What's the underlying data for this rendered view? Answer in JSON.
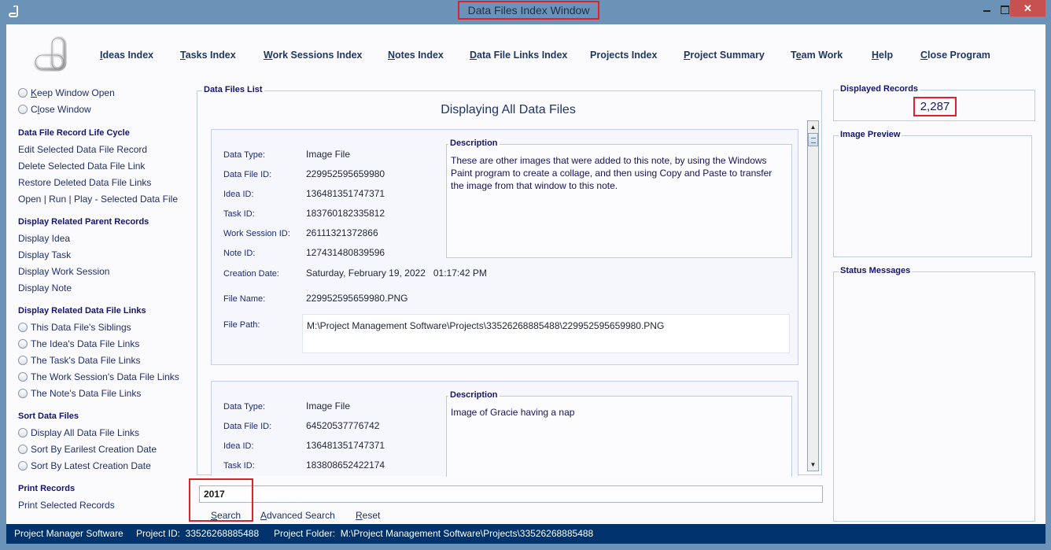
{
  "window": {
    "title": "Data Files Index Window",
    "close_glyph": "✕"
  },
  "nav": [
    {
      "mnemonic": "I",
      "rest": "deas Index"
    },
    {
      "mnemonic": "T",
      "rest": "asks Index"
    },
    {
      "mnemonic": "W",
      "rest": "ork Sessions Index"
    },
    {
      "mnemonic": "N",
      "rest": "otes Index"
    },
    {
      "mnemonic": "D",
      "rest": "ata File Links Index"
    },
    {
      "mnemonic": "",
      "rest": "Projects Index"
    },
    {
      "mnemonic": "P",
      "rest": "roject Summary"
    },
    {
      "pre": "T",
      "mnemonic": "e",
      "rest": "am Work"
    },
    {
      "mnemonic": "H",
      "rest": "elp"
    },
    {
      "mnemonic": "C",
      "rest": "lose Program"
    }
  ],
  "sidebar": {
    "window_options": [
      {
        "pre": "",
        "mnemonic": "K",
        "rest": "eep Window Open"
      },
      {
        "pre": "C",
        "mnemonic": "l",
        "rest": "ose Window"
      }
    ],
    "lifecycle": {
      "heading": "Data File Record Life Cycle",
      "items": [
        "Edit Selected Data File Record",
        "Delete Selected Data File Link",
        "Restore Deleted Data File Links",
        "Open | Run | Play - Selected Data File"
      ]
    },
    "parents": {
      "heading": "Display Related Parent Records",
      "items": [
        "Display Idea",
        "Display Task",
        "Display Work Session",
        "Display Note"
      ]
    },
    "links": {
      "heading": "Display Related Data File Links",
      "items": [
        "This Data File's Siblings",
        "The Idea's Data File Links",
        "The Task's Data File Links",
        "The Work Session's Data File Links",
        "The Note's Data File Links"
      ]
    },
    "sort": {
      "heading": "Sort Data Files",
      "items": [
        "Display All Data File Links",
        "Sort By Earilest Creation Date",
        "Sort By Latest Creation Date"
      ]
    },
    "print": {
      "heading": "Print Records",
      "items": [
        "Print Selected Records"
      ]
    }
  },
  "list": {
    "legend": "Data Files List",
    "heading": "Displaying All Data Files",
    "labels": {
      "data_type": "Data Type:",
      "data_file_id": "Data File ID:",
      "idea_id": "Idea ID:",
      "task_id": "Task ID:",
      "work_session_id": "Work Session ID:",
      "note_id": "Note ID:",
      "creation_date": "Creation Date:",
      "file_name": "File Name:",
      "file_path": "File Path:",
      "description": "Description"
    },
    "records": [
      {
        "data_type": "Image File",
        "data_file_id": "229952595659980",
        "idea_id": "136481351747371",
        "task_id": "183760182335812",
        "work_session_id": "26111321372866",
        "note_id": "127431480839596",
        "creation_date": "Saturday, February 19, 2022   01:17:42 PM",
        "file_name": "229952595659980.PNG",
        "file_path": "M:\\Project Management Software\\Projects\\33526268885488\\229952595659980.PNG",
        "description": "These are other images that were added to this note, by using the Windows Paint program to create a collage, and then using Copy and Paste to transfer the image from that window to this note."
      },
      {
        "data_type": "Image File",
        "data_file_id": "64520537776742",
        "idea_id": "136481351747371",
        "task_id": "183808652422174",
        "description": "Image of Gracie having a nap"
      }
    ]
  },
  "search": {
    "value": "2017",
    "search_mnemonic": "S",
    "search_rest": "earch",
    "advanced_mnemonic": "A",
    "advanced_rest": "dvanced Search",
    "reset_mnemonic": "R",
    "reset_rest": "eset"
  },
  "right_panel": {
    "displayed_records_label": "Displayed Records",
    "displayed_records_value": "2,287",
    "image_preview_label": "Image Preview",
    "status_messages_label": "Status Messages"
  },
  "statusbar": {
    "app": "Project Manager Software",
    "project_id": "Project ID:  33526268885488",
    "project_folder": "Project Folder:  M:\\Project Management Software\\Projects\\33526268885488"
  },
  "colors": {
    "frame": "#6b93b8",
    "statusbar": "#00336b",
    "highlight": "#e0202a",
    "close_button": "#c75050"
  }
}
